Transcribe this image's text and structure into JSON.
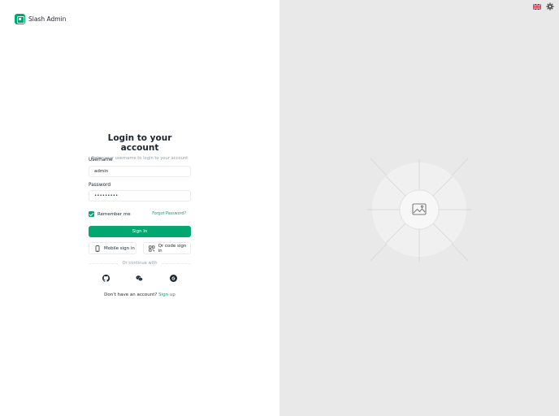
{
  "brand": {
    "name": "Slash Admin",
    "logo_icon": "logo-icon"
  },
  "header": {
    "language_icon": "uk-flag-icon",
    "settings_icon": "gear-icon"
  },
  "login": {
    "title": "Login to your account",
    "subtitle": "Enter your username to login to your account",
    "username_label": "Username",
    "username_value": "admin",
    "password_label": "Password",
    "password_value": "•••••••••",
    "remember_label": "Remember me",
    "remember_checked": true,
    "forgot_label": "Forgot Password?",
    "signin_label": "Sign In",
    "mobile_signin_label": "Mobile sign in",
    "qr_signin_label": "Qr code sign in",
    "divider_text": "Or continue with",
    "social": [
      "github-icon",
      "wechat-icon",
      "google-icon"
    ],
    "no_account_text": "Don't have an account?",
    "signup_label": "Sign up"
  },
  "illustration": {
    "icon": "image-placeholder-icon"
  },
  "colors": {
    "accent": "#00a76f",
    "panel_bg": "#e9e9e9",
    "text": "#1c252e",
    "muted": "#919eab"
  }
}
